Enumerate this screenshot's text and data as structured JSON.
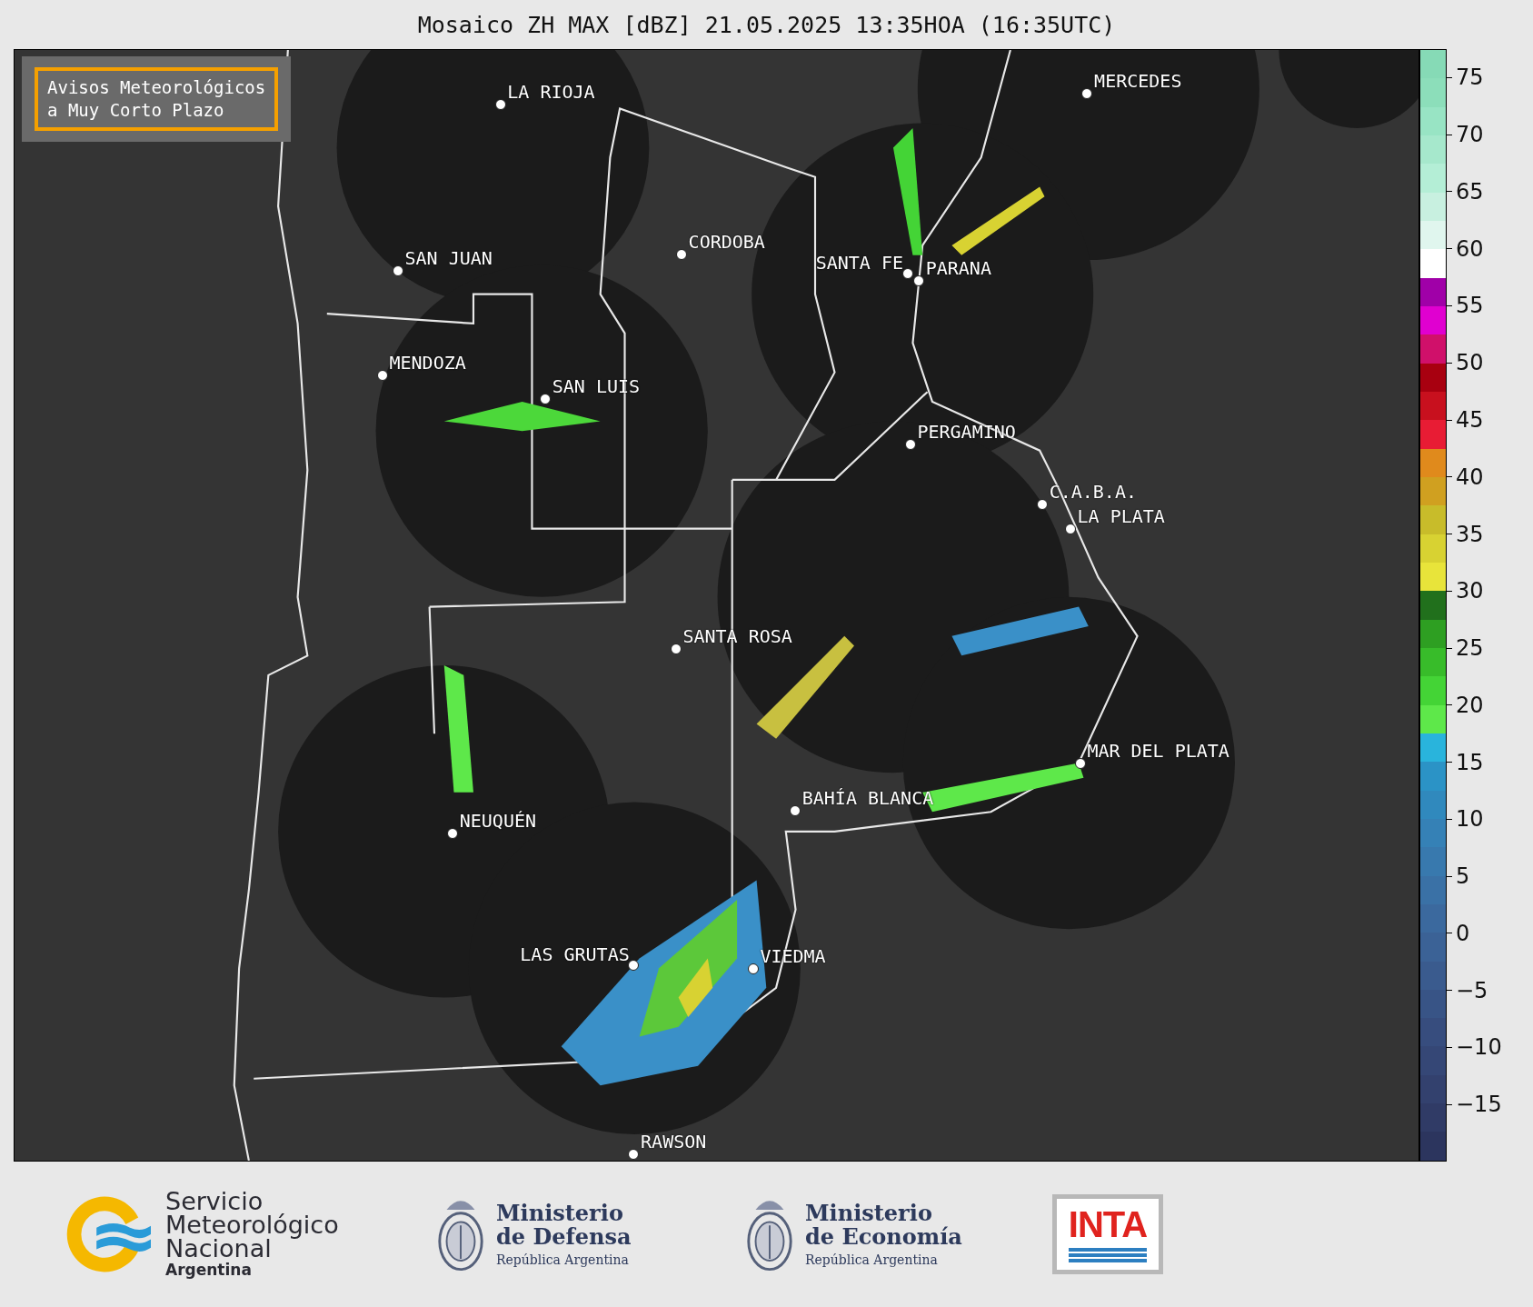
{
  "title": "Mosaico ZH MAX [dBZ] 21.05.2025 13:35HOA (16:35UTC)",
  "map": {
    "notice_lines": [
      "Avisos Meteorológicos",
      "a Muy Corto Plazo"
    ],
    "cities": [
      {
        "name": "LA RIOJA"
      },
      {
        "name": "MERCEDES"
      },
      {
        "name": "CORDOBA"
      },
      {
        "name": "SAN JUAN"
      },
      {
        "name": "SANTA FE"
      },
      {
        "name": "PARANA"
      },
      {
        "name": "MENDOZA"
      },
      {
        "name": "SAN LUIS"
      },
      {
        "name": "PERGAMINO"
      },
      {
        "name": "C.A.B.A."
      },
      {
        "name": "LA PLATA"
      },
      {
        "name": "SANTA ROSA"
      },
      {
        "name": "MAR DEL PLATA"
      },
      {
        "name": "BAHÍA BLANCA"
      },
      {
        "name": "NEUQUÉN"
      },
      {
        "name": "LAS GRUTAS"
      },
      {
        "name": "VIEDMA"
      },
      {
        "name": "RAWSON"
      }
    ]
  },
  "colorbar": {
    "bands": [
      {
        "color": "#2c355e"
      },
      {
        "color": "#303b66"
      },
      {
        "color": "#33416e"
      },
      {
        "color": "#354776"
      },
      {
        "color": "#374d7e"
      },
      {
        "color": "#385486"
      },
      {
        "color": "#3a5b8e"
      },
      {
        "color": "#3b6296"
      },
      {
        "color": "#3b699e"
      },
      {
        "color": "#3a71a6"
      },
      {
        "color": "#3879ae"
      },
      {
        "color": "#3581b6"
      },
      {
        "color": "#3089bd"
      },
      {
        "color": "#2b93c6"
      },
      {
        "color": "#29b4dc"
      },
      {
        "color": "#5ee84a"
      },
      {
        "color": "#44d436"
      },
      {
        "color": "#38bc2a"
      },
      {
        "color": "#2e9f22"
      },
      {
        "color": "#21701c"
      },
      {
        "color": "#e8e43a"
      },
      {
        "color": "#d8d232"
      },
      {
        "color": "#c8bc2a"
      },
      {
        "color": "#d0a020"
      },
      {
        "color": "#e08a1c"
      },
      {
        "color": "#e81c34"
      },
      {
        "color": "#c8101e"
      },
      {
        "color": "#a80010"
      },
      {
        "color": "#d0106a"
      },
      {
        "color": "#e000d0"
      },
      {
        "color": "#a000a8"
      },
      {
        "color": "#ffffff"
      },
      {
        "color": "#e0f6ee"
      },
      {
        "color": "#c8f0e0"
      },
      {
        "color": "#b4eed6"
      },
      {
        "color": "#a6e8cc"
      },
      {
        "color": "#98e4c4"
      },
      {
        "color": "#8cdeba"
      },
      {
        "color": "#86dab6"
      }
    ],
    "ticks": [
      "75",
      "70",
      "65",
      "60",
      "55",
      "50",
      "45",
      "40",
      "35",
      "30",
      "25",
      "20",
      "15",
      "10",
      "5",
      "0",
      "−5",
      "−10",
      "−15"
    ]
  },
  "footer": {
    "logos": [
      {
        "kind": "smn",
        "lines": [
          "Servicio",
          "Meteorológico",
          "Nacional"
        ],
        "subtitle": "Argentina"
      },
      {
        "kind": "ministry",
        "lines": [
          "Ministerio",
          "de Defensa"
        ],
        "subtitle": "República Argentina"
      },
      {
        "kind": "ministry",
        "lines": [
          "Ministerio",
          "de Economía"
        ],
        "subtitle": "República Argentina"
      },
      {
        "kind": "inta",
        "text": "INTA"
      }
    ]
  }
}
